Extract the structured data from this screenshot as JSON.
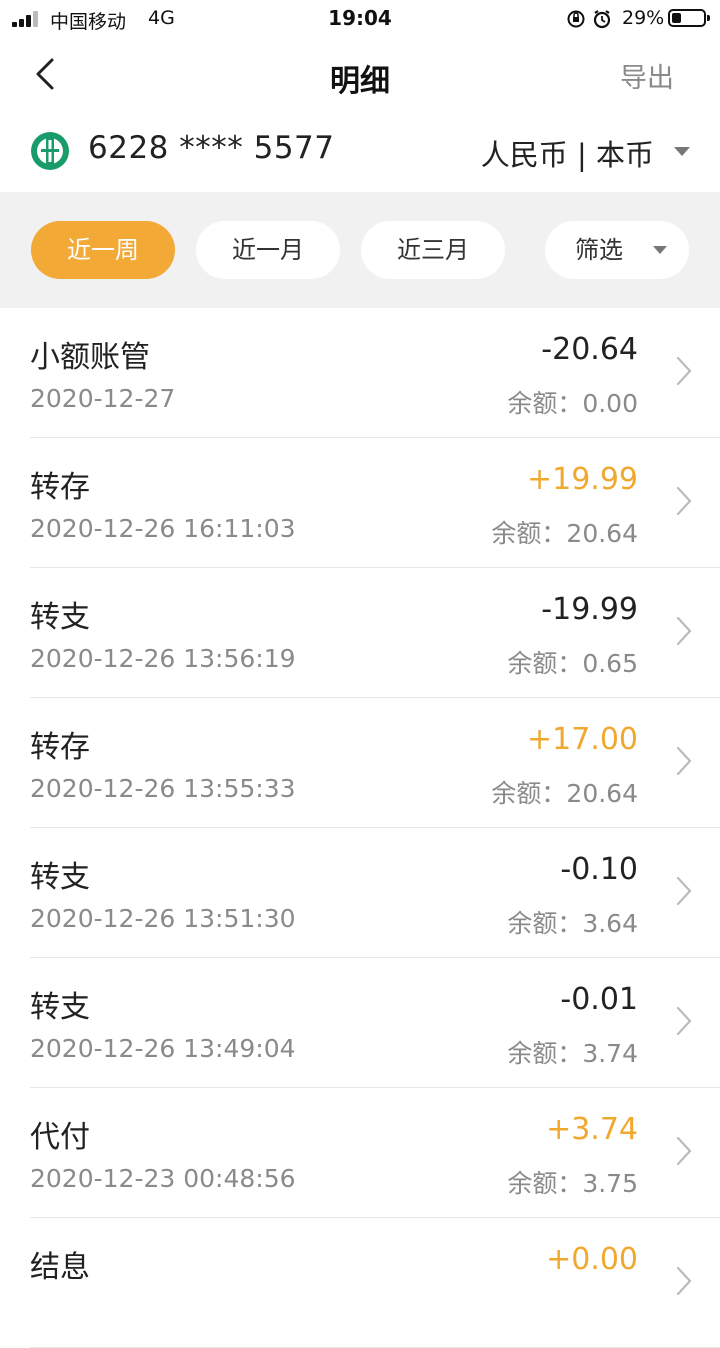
{
  "status_bar": {
    "carrier": "中国移动",
    "network": "4G",
    "time": "19:04",
    "battery": "29%",
    "battery_level": 0.29
  },
  "nav": {
    "title": "明细",
    "export_label": "导出"
  },
  "account": {
    "number": "6228 **** 5577",
    "currency": "人民币 | 本币"
  },
  "filters": [
    {
      "label": "近一周",
      "active": true
    },
    {
      "label": "近一月",
      "active": false
    },
    {
      "label": "近三月",
      "active": false
    },
    {
      "label": "筛选",
      "active": false
    }
  ],
  "transactions": [
    {
      "name": "小额账管",
      "date": "2020-12-27",
      "amount": "-20.64",
      "balance": "余额：0.00",
      "positive": false
    },
    {
      "name": "转存",
      "date": "2020-12-26 16:11:03",
      "amount": "+19.99",
      "balance": "余额：20.64",
      "positive": true
    },
    {
      "name": "转支",
      "date": "2020-12-26 13:56:19",
      "amount": "-19.99",
      "balance": "余额：0.65",
      "positive": false
    },
    {
      "name": "转存",
      "date": "2020-12-26 13:55:33",
      "amount": "+17.00",
      "balance": "余额：20.64",
      "positive": true
    },
    {
      "name": "转支",
      "date": "2020-12-26 13:51:30",
      "amount": "-0.10",
      "balance": "余额：3.64",
      "positive": false
    },
    {
      "name": "转支",
      "date": "2020-12-26 13:49:04",
      "amount": "-0.01",
      "balance": "余额：3.74",
      "positive": false
    },
    {
      "name": "代付",
      "date": "2020-12-23 00:48:56",
      "amount": "+3.74",
      "balance": "余额：3.75",
      "positive": true
    },
    {
      "name": "结息",
      "date": "",
      "amount": "+0.00",
      "balance": "",
      "positive": true
    }
  ],
  "colors": {
    "accent": "#f2a936",
    "positive_amount": "#f0a92e",
    "bank_green": "#1a9b6a"
  },
  "icons": {
    "back": "chevron-left-icon",
    "bank": "abc-bank-logo-icon",
    "row": "chevron-right-icon"
  }
}
